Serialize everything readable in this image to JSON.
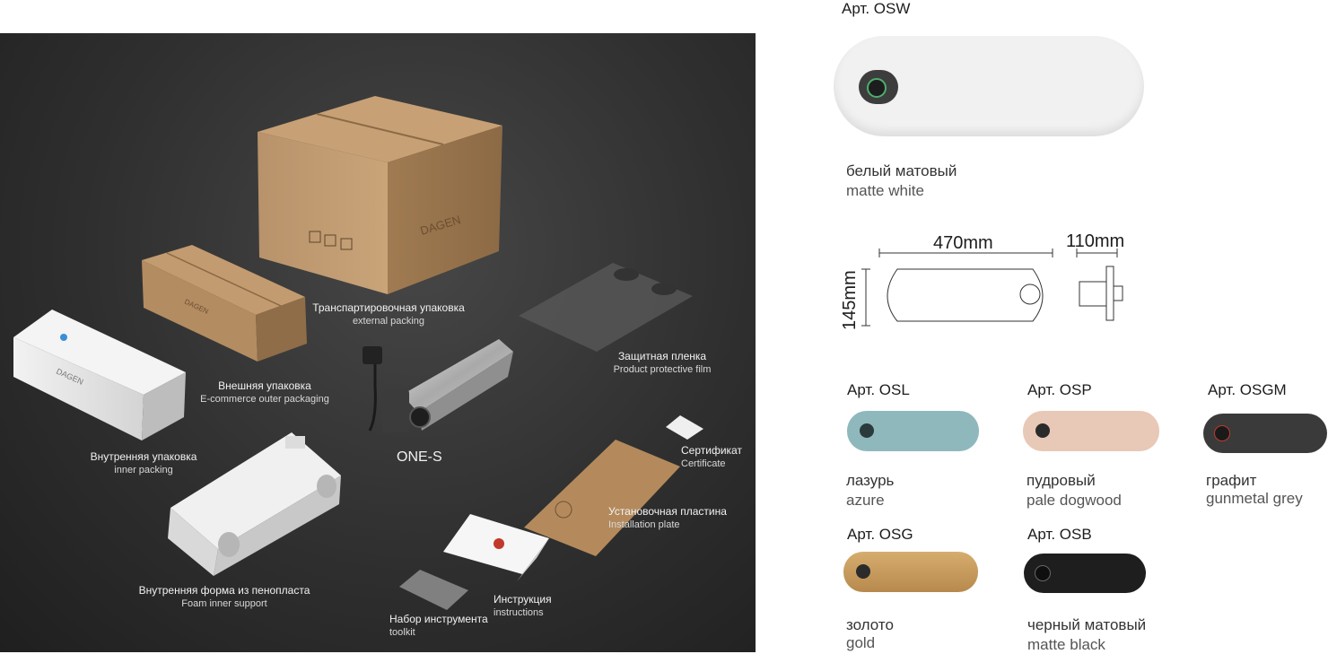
{
  "photo": {
    "brand": "DAGEN",
    "product_name": "ONE-S",
    "labels": {
      "transport": {
        "ru": "Транспартировочная упаковка",
        "en": "external packing"
      },
      "outer": {
        "ru": "Внешняя упаковка",
        "en": "E-commerce outer packaging"
      },
      "inner": {
        "ru": "Внутренняя упаковка",
        "en": "inner packing"
      },
      "foam": {
        "ru": "Внутренняя форма из пенопласта",
        "en": "Foam inner support"
      },
      "film": {
        "ru": "Защитная пленка",
        "en": "Product protective film"
      },
      "certificate": {
        "ru": "Сертификат",
        "en": "Certificate"
      },
      "plate": {
        "ru": "Установочная пластина",
        "en": "Installation plate"
      },
      "instructions": {
        "ru": "Инструкция",
        "en": "instructions"
      },
      "toolkit": {
        "ru": "Набор инструмента",
        "en": "toolkit"
      }
    }
  },
  "variants": {
    "osw": {
      "art": "Арт. OSW",
      "ru": "белый матовый",
      "en": "matte white",
      "color": "#f1f1f1"
    },
    "osl": {
      "art": "Арт. OSL",
      "ru": "лазурь",
      "en": "azure",
      "color": "#8fb8bc"
    },
    "osp": {
      "art": "Арт. OSP",
      "ru": "пудровый",
      "en": "pale dogwood",
      "color": "#e8c8b6"
    },
    "osgm": {
      "art": "Арт. OSGM",
      "ru": "графит",
      "en": "gunmetal grey",
      "color": "#3a3a3a"
    },
    "osg": {
      "art": "Арт. OSG",
      "ru": "золото",
      "en": "gold",
      "color": "#c5995a"
    },
    "osb": {
      "art": "Арт. OSB",
      "ru": "черный матовый",
      "en": "matte black",
      "color": "#1e1e1e"
    }
  },
  "dimensions": {
    "length": "470mm",
    "depth": "110mm",
    "height": "145mm"
  }
}
